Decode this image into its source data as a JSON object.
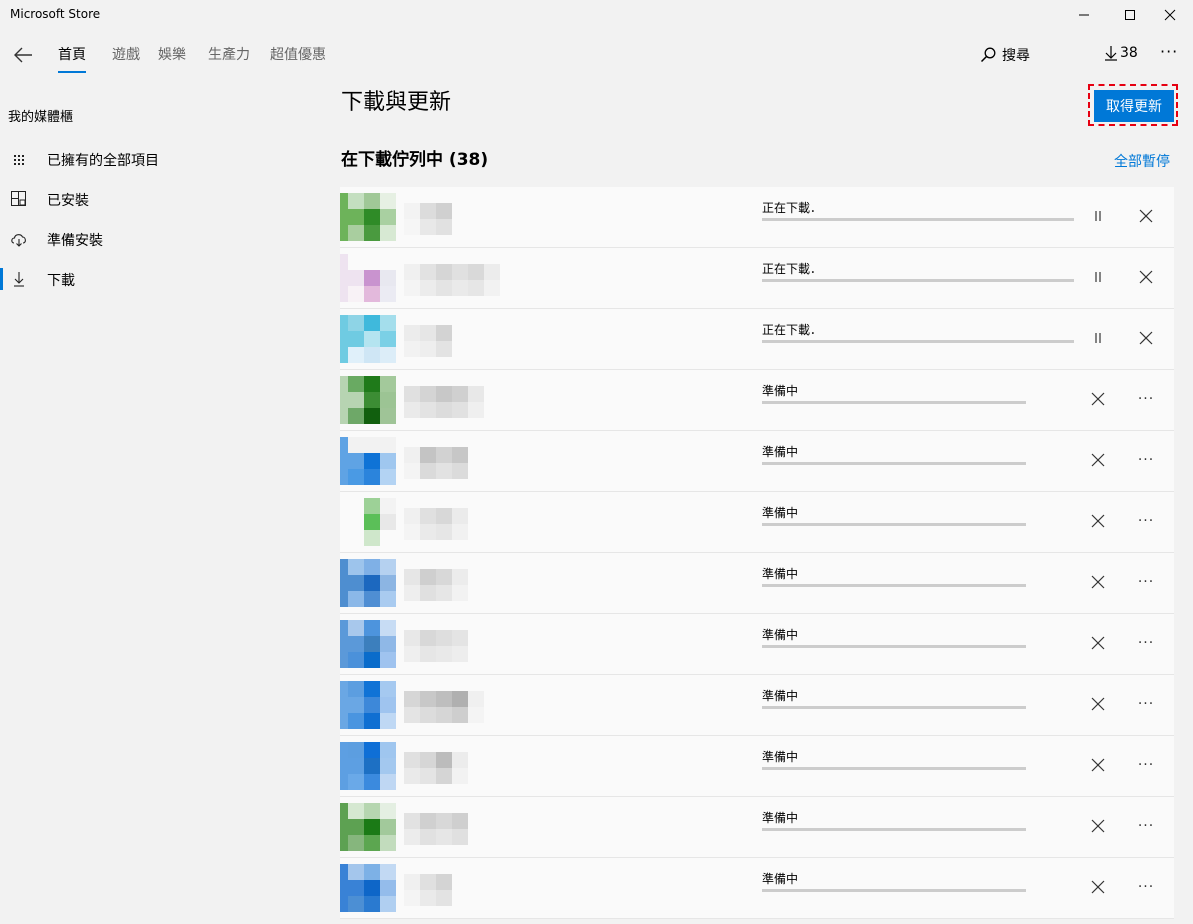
{
  "window": {
    "title": "Microsoft Store"
  },
  "nav": {
    "tabs": [
      "首頁",
      "遊戲",
      "娛樂",
      "生產力",
      "超值優惠"
    ],
    "active_tab": 0,
    "search_label": "搜尋",
    "download_count": "38",
    "more_label": "···"
  },
  "sidebar": {
    "title": "我的媒體櫃",
    "items": [
      {
        "label": "已擁有的全部項目",
        "icon": "grid-icon"
      },
      {
        "label": "已安裝",
        "icon": "installed-icon"
      },
      {
        "label": "準備安裝",
        "icon": "cloud-download-icon"
      },
      {
        "label": "下載",
        "icon": "download-icon"
      }
    ],
    "active_index": 3
  },
  "main": {
    "title": "下載與更新",
    "get_updates_label": "取得更新",
    "queue_title": "在下載佇列中 (38)",
    "pause_all_label": "全部暫停",
    "rows": [
      {
        "status": "正在下載．",
        "state": "downloading",
        "thumb": [
          "#c4dfc0",
          "#a0c897",
          "#e6f0e3",
          "#6db35a",
          "#2f8b27",
          "#a9d0a1",
          "#a9ce9f",
          "#4a9a3f",
          "#d7e9d3"
        ],
        "name": [
          "#f3f3f3",
          "#dcdcdc",
          "#d0d0d0"
        ]
      },
      {
        "status": "正在下載．",
        "state": "downloading",
        "thumb": [
          "#fafafa",
          "#fafafa",
          "#fafafa",
          "#eee3f0",
          "#c993cf",
          "#e8e8f0",
          "#f8f2f6",
          "#e3b9dc",
          "#ebebf3"
        ],
        "name": [
          "#f0f0f0",
          "#e2e2e2",
          "#d6d6d6",
          "#e0e0e0",
          "#d9d9d9",
          "#ececec"
        ]
      },
      {
        "status": "正在下載．",
        "state": "downloading",
        "thumb": [
          "#8ed4e6",
          "#3fb9dc",
          "#a4deec",
          "#6fcbe2",
          "#b4e4f0",
          "#7bd0e6",
          "#e0f0fa",
          "#cfe6f5",
          "#dcedf8"
        ],
        "name": [
          "#ececec",
          "#e6e6e6",
          "#d3d3d3"
        ]
      },
      {
        "status": "準備中",
        "state": "queued",
        "thumb": [
          "#69aa62",
          "#1f7a1a",
          "#a3c99b",
          "#b7d4b2",
          "#3c8d34",
          "#9cc494",
          "#6ea868",
          "#115f0e",
          "#9fc497"
        ],
        "name": [
          "#e0e0e0",
          "#d4d4d4",
          "#c8c8c8",
          "#d0d0d0",
          "#e8e8e8"
        ]
      },
      {
        "status": "準備中",
        "state": "queued",
        "thumb": [
          "#f2f2f2",
          "#f2f2f2",
          "#f2f2f2",
          "#5fa3e4",
          "#0f73d6",
          "#9fc7ef",
          "#4a9ae4",
          "#2b84dc",
          "#b3d3f3"
        ],
        "name": [
          "#f0f0f0",
          "#c4c4c4",
          "#d2d2d2",
          "#c7c7c7"
        ]
      },
      {
        "status": "準備中",
        "state": "queued",
        "thumb": [
          "#fafafa",
          "#9dd197",
          "#f3f3f3",
          "#fafafa",
          "#5bbf58",
          "#e8e8e8",
          "#fafafa",
          "#cfe7cb",
          "#fafafa"
        ],
        "name": [
          "#f0f0f0",
          "#e0e0e0",
          "#d8d8d8",
          "#ebebeb"
        ]
      },
      {
        "status": "準備中",
        "state": "queued",
        "thumb": [
          "#9dc4ec",
          "#7fb0e6",
          "#b5d1f0",
          "#4e8ed0",
          "#1c68bf",
          "#8cb5e3",
          "#8bb8e8",
          "#4f8ed3",
          "#a9cbf0"
        ],
        "name": [
          "#e6e6e6",
          "#cfcfcf",
          "#d8d8d8",
          "#ececec"
        ]
      },
      {
        "status": "準備中",
        "state": "queued",
        "thumb": [
          "#a8c8ec",
          "#4d94dd",
          "#c7dcf4",
          "#5b99d9",
          "#3c7fbd",
          "#8fb8e7",
          "#4b91da",
          "#0a6ccb",
          "#9fc3ef"
        ],
        "name": [
          "#e8e8e8",
          "#d8d8d8",
          "#dedede",
          "#e4e4e4"
        ]
      },
      {
        "status": "準備中",
        "state": "queued",
        "thumb": [
          "#5c9ee0",
          "#1073d6",
          "#a5c9f0",
          "#6aa7e4",
          "#3d88d9",
          "#9fc4ef",
          "#4a95e0",
          "#0f6fd2",
          "#bfd8f4"
        ],
        "name": [
          "#d6d6d6",
          "#c8c8c8",
          "#bebebe",
          "#b0b0b0",
          "#f0f0f0"
        ]
      },
      {
        "status": "準備中",
        "state": "queued",
        "thumb": [
          "#5c9ee0",
          "#0f6fd6",
          "#9fc6ef",
          "#5d9fe2",
          "#1d70c4",
          "#a3c8ef",
          "#6aa9e8",
          "#3b8ade",
          "#bfd7f3"
        ],
        "name": [
          "#e0e0e0",
          "#d6d6d6",
          "#bcbcbc",
          "#ececec"
        ]
      },
      {
        "status": "準備中",
        "state": "queued",
        "thumb": [
          "#d5e8d1",
          "#b6d6b0",
          "#e4efe2",
          "#5da152",
          "#1b7a16",
          "#a2c99b",
          "#86b67d",
          "#5ca650",
          "#c2dcbd"
        ],
        "name": [
          "#e2e2e2",
          "#d0d0d0",
          "#d8d8d8",
          "#cfcfcf"
        ]
      },
      {
        "status": "準備中",
        "state": "queued",
        "thumb": [
          "#a4c6ec",
          "#7db1e6",
          "#c2d9f3",
          "#3982d6",
          "#0e66c8",
          "#94bceb",
          "#4c8fd4",
          "#2a7ad0",
          "#b0cff1"
        ],
        "name": [
          "#f0f0f0",
          "#e0e0e0",
          "#d4d4d4"
        ]
      }
    ]
  }
}
